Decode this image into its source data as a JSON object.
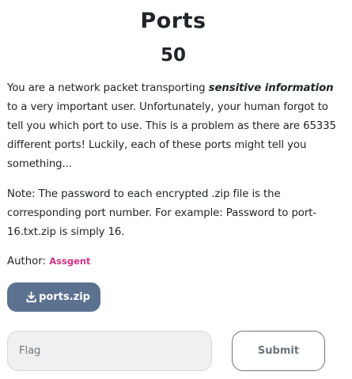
{
  "challenge": {
    "name": "Ports",
    "value": "50",
    "description": {
      "intro_before": "You are a network packet transporting ",
      "intro_emphasis": "sensitive information",
      "intro_after": " to a very important user. Unfortunately, your human forgot to tell you which port to use. This is a problem as there are 65335 different ports! Luckily, each of these ports might tell you something...",
      "note": "Note: The password to each encrypted .zip file is the corresponding port number. For example: Password to port-16.txt.zip is simply 16."
    },
    "author_label": "Author: ",
    "author_name": "Assgent",
    "files": [
      {
        "label": "ports.zip",
        "icon": "download-icon"
      }
    ]
  },
  "submission": {
    "flag_placeholder": "Flag",
    "flag_value": "",
    "submit_label": "Submit"
  },
  "colors": {
    "file_button": "#5b7190",
    "author": "#d63384",
    "input_bg": "#f0f0f0",
    "submit_border": "#6c757d"
  }
}
